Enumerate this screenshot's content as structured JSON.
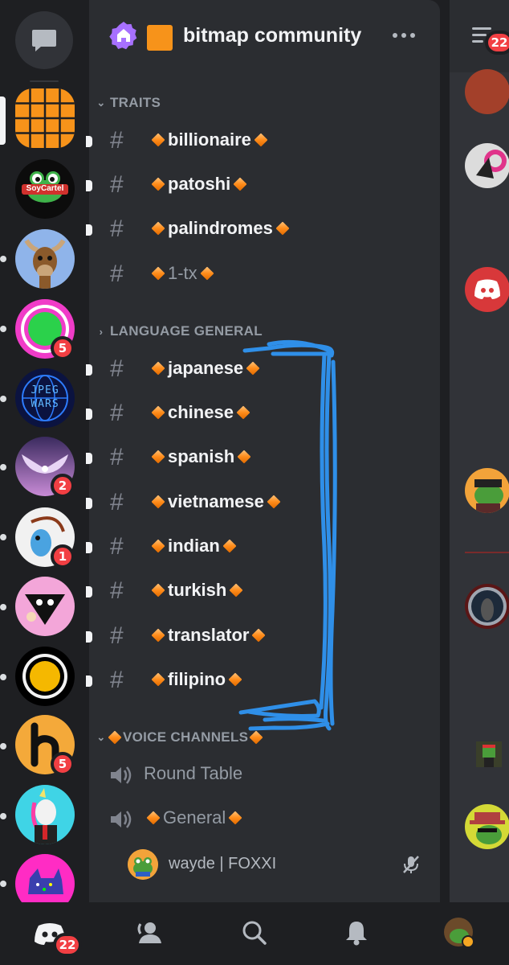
{
  "server": {
    "name": "bitmap community"
  },
  "categories": {
    "traits": "TRAITS",
    "language_general": "LANGUAGE GENERAL",
    "voice_channels": "VOICE CHANNELS"
  },
  "channels": [
    {
      "name": "billionaire",
      "unread": true
    },
    {
      "name": "patoshi",
      "unread": true
    },
    {
      "name": "palindromes",
      "unread": true
    },
    {
      "name": "1-tx",
      "unread": false
    },
    {
      "name": "japanese",
      "unread": true
    },
    {
      "name": "chinese",
      "unread": true
    },
    {
      "name": "spanish",
      "unread": true
    },
    {
      "name": "vietnamese",
      "unread": true
    },
    {
      "name": "indian",
      "unread": true
    },
    {
      "name": "turkish",
      "unread": true
    },
    {
      "name": "translator",
      "unread": true
    },
    {
      "name": "filipino",
      "unread": true
    }
  ],
  "voice": {
    "channels": [
      {
        "name": "Round Table"
      },
      {
        "name": "General"
      }
    ],
    "user": "wayde | FOXXI"
  },
  "rail_badges": {
    "s4": "5",
    "s6": "2",
    "s7": "1",
    "s10": "5"
  },
  "rail_logos": {
    "soycartel": "SoyCartel",
    "jpeg_wars_1": "JPEG",
    "jpeg_wars_2": "WARS"
  },
  "header_badge": "22",
  "nav_badge": "22",
  "colors": {
    "accent_orange": "#f7931a",
    "badge_red": "#f23f43",
    "annotation_blue": "#2f8fe8",
    "panel": "#2b2d31",
    "rail": "#1e1f22"
  },
  "icons": [
    "chat-bubble-icon",
    "home-icon",
    "more-icon",
    "hash-icon",
    "speaker-icon",
    "mic-off-icon",
    "discord-icon",
    "friends-icon",
    "search-icon",
    "bell-icon",
    "members-icon"
  ]
}
